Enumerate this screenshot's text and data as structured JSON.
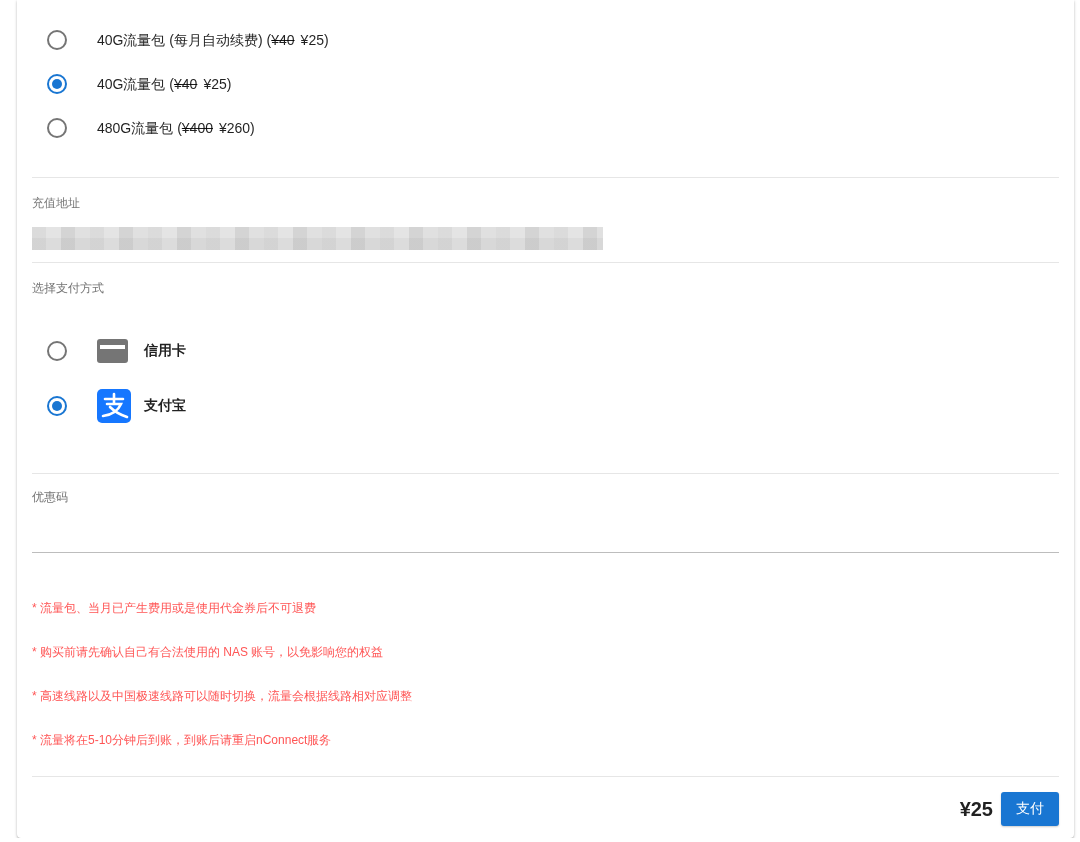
{
  "plans": [
    {
      "label": "40G流量包 (每月自动续费) (",
      "original_price": "¥40",
      "price": "¥25)",
      "selected": false
    },
    {
      "label": "40G流量包 (",
      "original_price": "¥40",
      "price": "¥25)",
      "selected": true
    },
    {
      "label": "480G流量包 (",
      "original_price": "¥400",
      "price": "¥260)",
      "selected": false
    }
  ],
  "address": {
    "label": "充值地址",
    "value_redacted": true
  },
  "payment": {
    "label": "选择支付方式",
    "methods": [
      {
        "kind": "card",
        "name": "信用卡",
        "selected": false
      },
      {
        "kind": "app",
        "name": "支付宝",
        "selected": true
      }
    ]
  },
  "coupon": {
    "label": "优惠码"
  },
  "notes": [
    "* 流量包、当月已产生费用或是使用代金券后不可退费",
    "* 购买前请先确认自己有合法使用的 NAS 账号，以免影响您的权益",
    "* 高速线路以及中国极速线路可以随时切换，流量会根据线路相对应调整",
    "* 流量将在5-10分钟后到账，到账后请重启nConnect服务"
  ],
  "footer": {
    "total": "¥25",
    "pay_button": "支付"
  }
}
